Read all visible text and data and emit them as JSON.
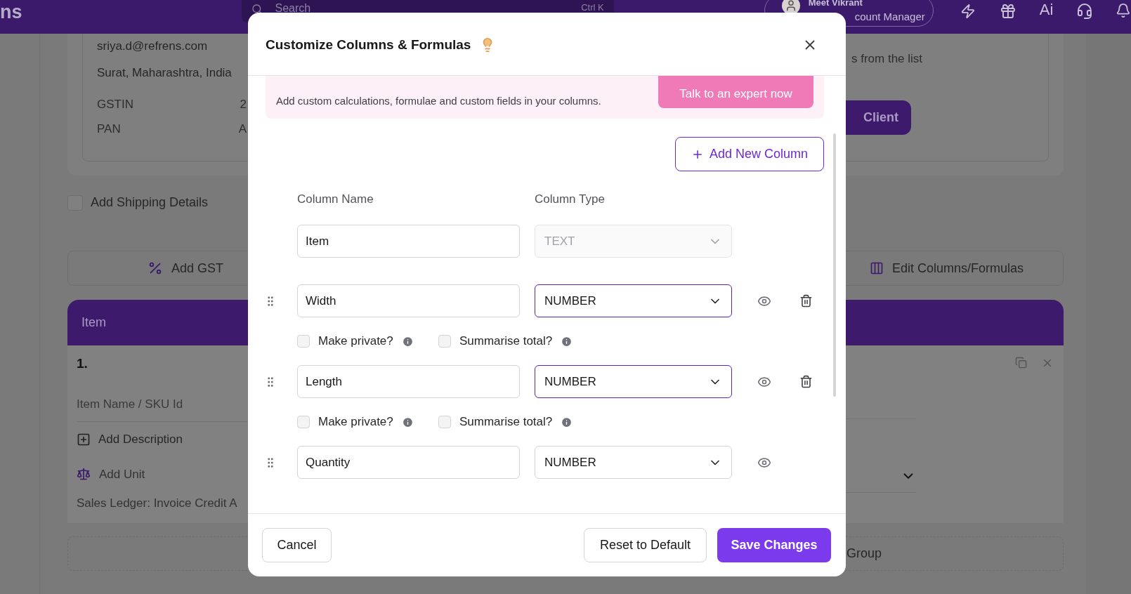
{
  "topbar": {
    "logo": "ns",
    "search": {
      "placeholder": "Search",
      "shortcut": "Ctrl K"
    },
    "user": {
      "name": "Meet Vikrant",
      "role": "count Manager"
    },
    "ai_label": "Ai"
  },
  "client": {
    "email": "sriya.d@refrens.com",
    "address": "Surat, Maharashtra, India",
    "fields": [
      {
        "label": "GSTIN",
        "value": "2"
      },
      {
        "label": "PAN",
        "value": "A"
      }
    ],
    "hint": "s from the list",
    "button": "Client"
  },
  "shipping": {
    "label": "Add Shipping Details",
    "checked": false
  },
  "actions": [
    {
      "label": "Add GST",
      "kind": "gst"
    },
    {
      "label": "Edit Columns/Formulas",
      "kind": "columns"
    }
  ],
  "items_table": {
    "header": "Item",
    "number": "1.",
    "name_placeholder": "Item Name / SKU Id",
    "add_description": "Add Description",
    "add_unit": "Add Unit",
    "ledger": "Sales Ledger: Invoice Credit A",
    "add_group": "Group"
  },
  "modal": {
    "title": "Customize Columns & Formulas",
    "banner": {
      "text": "Add custom calculations, formulae and custom fields in your columns.",
      "button": "Talk to an expert now"
    },
    "add_button": "Add New Column",
    "headers": [
      "Column Name",
      "Column Type"
    ],
    "columns": [
      {
        "name": "Item",
        "type": "TEXT",
        "locked": true,
        "highlighted": false,
        "deletable": false
      },
      {
        "name": "Width",
        "type": "NUMBER",
        "locked": false,
        "highlighted": true,
        "deletable": true,
        "options": [
          {
            "label": "Make private?",
            "checked": false
          },
          {
            "label": "Summarise total?",
            "checked": false
          }
        ]
      },
      {
        "name": "Length",
        "type": "NUMBER",
        "locked": false,
        "highlighted": true,
        "deletable": true,
        "options": [
          {
            "label": "Make private?",
            "checked": false
          },
          {
            "label": "Summarise total?",
            "checked": false
          }
        ]
      },
      {
        "name": "Quantity",
        "type": "NUMBER",
        "locked": false,
        "highlighted": false,
        "deletable": false
      }
    ],
    "footer": {
      "cancel": "Cancel",
      "reset": "Reset to Default",
      "save": "Save Changes"
    }
  }
}
